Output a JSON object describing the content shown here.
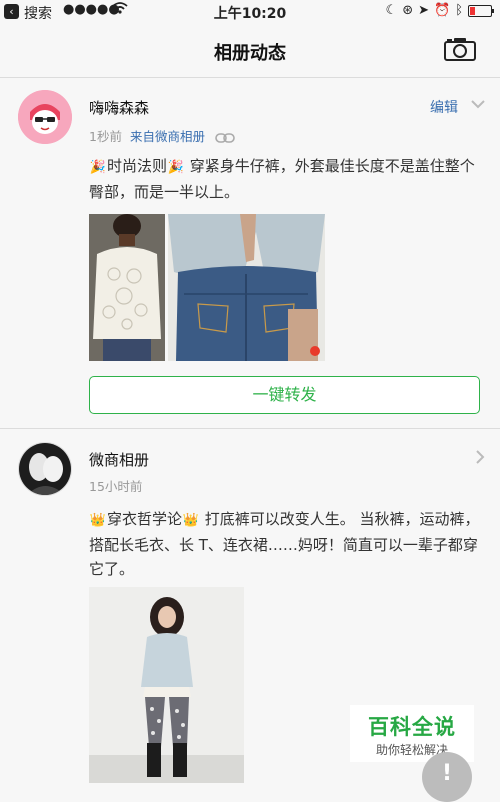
{
  "status_bar": {
    "back_label": "搜索",
    "signal": "●●●●●",
    "time": "上午10:20"
  },
  "nav": {
    "title": "相册动态"
  },
  "posts": [
    {
      "username": "嗨嗨森森",
      "time_ago": "1秒前",
      "source": "来自微商相册",
      "edit_label": "编辑",
      "text": "时尚法则",
      "text_rest": " 穿紧身牛仔裤，外套最佳长度不是盖住整个臀部，而是一半以上。",
      "repost_label": "一键转发",
      "emoji": "party-popper-emoji"
    },
    {
      "username": "微商相册",
      "time_ago": "15小时前",
      "text": "穿衣哲学论",
      "text_rest": " 打底裤可以改变人生。 当秋裤，运动裤，搭配长毛衣、长 T、连衣裙……妈呀！简直可以一辈子都穿它了。",
      "emoji": "crown-emoji"
    }
  ],
  "watermark": {
    "title": "百科全说",
    "subtitle": "助你轻松解决"
  },
  "fab_label": "!",
  "colors": {
    "accent_green": "#2fb24a",
    "link_blue": "#3a6fb0",
    "meta_gray": "#999999"
  }
}
